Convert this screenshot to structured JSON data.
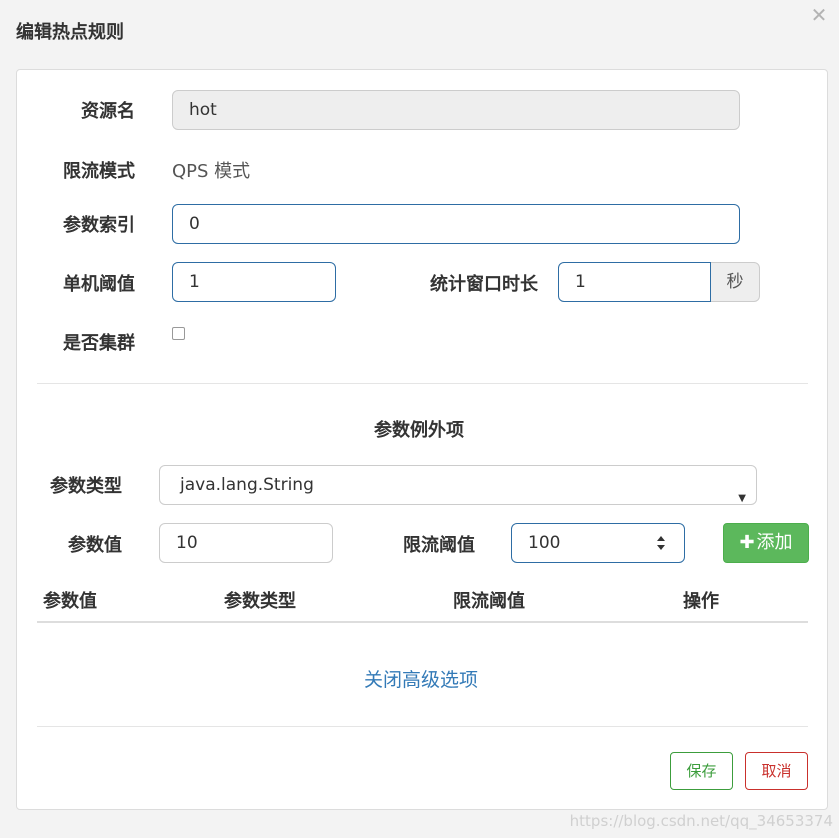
{
  "dialog": {
    "title": "编辑热点规则",
    "close_glyph": "✕"
  },
  "form": {
    "resource_label": "资源名",
    "resource_value": "hot",
    "mode_label": "限流模式",
    "mode_value": "QPS 模式",
    "param_index_label": "参数索引",
    "param_index_value": "0",
    "threshold_label": "单机阈值",
    "threshold_value": "1",
    "window_label": "统计窗口时长",
    "window_value": "1",
    "window_unit": "秒",
    "cluster_label": "是否集群",
    "cluster_checked": false
  },
  "exceptions": {
    "section_title": "参数例外项",
    "type_label": "参数类型",
    "type_selected": "java.lang.String",
    "value_label": "参数值",
    "value_input": "10",
    "limit_label": "限流阈值",
    "limit_input": "100",
    "add_button": "添加",
    "table": {
      "columns": [
        "参数值",
        "参数类型",
        "限流阈值",
        "操作"
      ],
      "rows": []
    }
  },
  "advanced_link": "关闭高级选项",
  "footer": {
    "save_label": "保存",
    "cancel_label": "取消"
  },
  "watermark": "https://blog.csdn.net/qq_34653374",
  "colors": {
    "primary_border": "#2e6da4",
    "success": "#5cb85c",
    "danger": "#c9302c",
    "link": "#337ab7"
  }
}
